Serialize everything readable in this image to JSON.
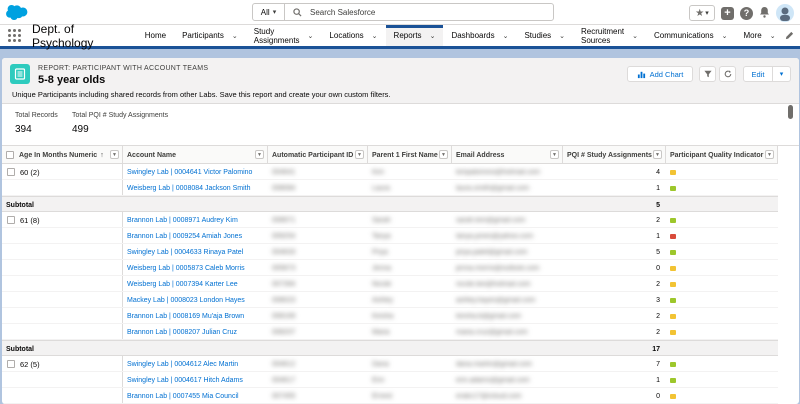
{
  "header": {
    "search_scope": "All",
    "search_placeholder": "Search Salesforce"
  },
  "nav": {
    "app_name": "Dept. of Psychology",
    "items": [
      {
        "label": "Home",
        "has_menu": false
      },
      {
        "label": "Participants",
        "has_menu": true
      },
      {
        "label": "Study Assignments",
        "has_menu": true
      },
      {
        "label": "Locations",
        "has_menu": true
      },
      {
        "label": "Reports",
        "has_menu": true,
        "active": true
      },
      {
        "label": "Dashboards",
        "has_menu": true
      },
      {
        "label": "Studies",
        "has_menu": true
      },
      {
        "label": "Recruitment Sources",
        "has_menu": true
      },
      {
        "label": "Communications",
        "has_menu": true
      },
      {
        "label": "More",
        "has_menu": true
      }
    ]
  },
  "report": {
    "type_label": "REPORT: PARTICIPANT WITH ACCOUNT TEAMS",
    "name": "5-8 year olds",
    "description": "Unique Participants including shared records from other Labs. Save this report and create your own custom filters.",
    "buttons": {
      "add_chart": "Add Chart",
      "edit": "Edit"
    },
    "summary": [
      {
        "label": "Total Records",
        "value": "394"
      },
      {
        "label": "Total PQI # Study Assignments",
        "value": "499"
      }
    ],
    "columns": [
      "Age In Months Numeric",
      "Account Name",
      "Automatic Participant ID",
      "Parent 1 First Name",
      "Email Address",
      "PQI # Study Assignments",
      "Participant Quality Indicator"
    ],
    "subtotal_label": "Subtotal",
    "groups": [
      {
        "label": "60 (2)",
        "rows": [
          {
            "account": "Swingley Lab | 0004641 Victor Palomino",
            "pid": "004641",
            "parent": "Kim",
            "email": "kimpalomino@hotmail.com",
            "pqi": "4",
            "quality": "yellow"
          },
          {
            "account": "Weisberg Lab | 0008084 Jackson Smith",
            "pid": "008084",
            "parent": "Laura",
            "email": "laura.smith@gmail.com",
            "pqi": "1",
            "quality": "green"
          }
        ],
        "subtotal": "5"
      },
      {
        "label": "61 (8)",
        "rows": [
          {
            "account": "Brannon Lab | 0008971 Audrey Kim",
            "pid": "008971",
            "parent": "Sarah",
            "email": "sarah.kim@gmail.com",
            "pqi": "2",
            "quality": "green"
          },
          {
            "account": "Brannon Lab | 0009254 Amiah Jones",
            "pid": "009254",
            "parent": "Tanya",
            "email": "tanya.jones@yahoo.com",
            "pqi": "1",
            "quality": "red"
          },
          {
            "account": "Swingley Lab | 0004633 Rinaya Patel",
            "pid": "004633",
            "parent": "Priya",
            "email": "priya.patel@gmail.com",
            "pqi": "5",
            "quality": "green"
          },
          {
            "account": "Weisberg Lab | 0005873 Caleb Morris",
            "pid": "005873",
            "parent": "Jenna",
            "email": "jenna.morris@outlook.com",
            "pqi": "0",
            "quality": "yellow"
          },
          {
            "account": "Weisberg Lab | 0007394 Karter Lee",
            "pid": "007394",
            "parent": "Nicole",
            "email": "nicole.lee@hotmail.com",
            "pqi": "2",
            "quality": "yellow"
          },
          {
            "account": "Mackey Lab | 0008023 London Hayes",
            "pid": "008023",
            "parent": "Ashley",
            "email": "ashley.hayes@gmail.com",
            "pqi": "3",
            "quality": "green"
          },
          {
            "account": "Brannon Lab | 0008169 Mu'aja Brown",
            "pid": "008169",
            "parent": "Keisha",
            "email": "keisha.b@gmail.com",
            "pqi": "2",
            "quality": "yellow"
          },
          {
            "account": "Brannon Lab | 0008207 Julian Cruz",
            "pid": "008207",
            "parent": "Maria",
            "email": "maria.cruz@gmail.com",
            "pqi": "2",
            "quality": "yellow"
          }
        ],
        "subtotal": "17"
      },
      {
        "label": "62 (5)",
        "rows": [
          {
            "account": "Swingley Lab | 0004612 Alec Martin",
            "pid": "004612",
            "parent": "Dana",
            "email": "dana.martin@gmail.com",
            "pqi": "7",
            "quality": "green"
          },
          {
            "account": "Swingley Lab | 0004617 Hitch Adams",
            "pid": "004617",
            "parent": "Erin",
            "email": "erin.adams@gmail.com",
            "pqi": "1",
            "quality": "green"
          },
          {
            "account": "Brannon Lab | 0007455 Mia Council",
            "pid": "007455",
            "parent": "Ernest",
            "email": "eratic17@icloud.com",
            "pqi": "0",
            "quality": "yellow"
          }
        ]
      }
    ]
  },
  "colors": {
    "brand": "#1b5297",
    "link": "#0070d2",
    "quality_green": "#9dc72b",
    "quality_yellow": "#f2c333",
    "quality_red": "#d94b3b"
  }
}
